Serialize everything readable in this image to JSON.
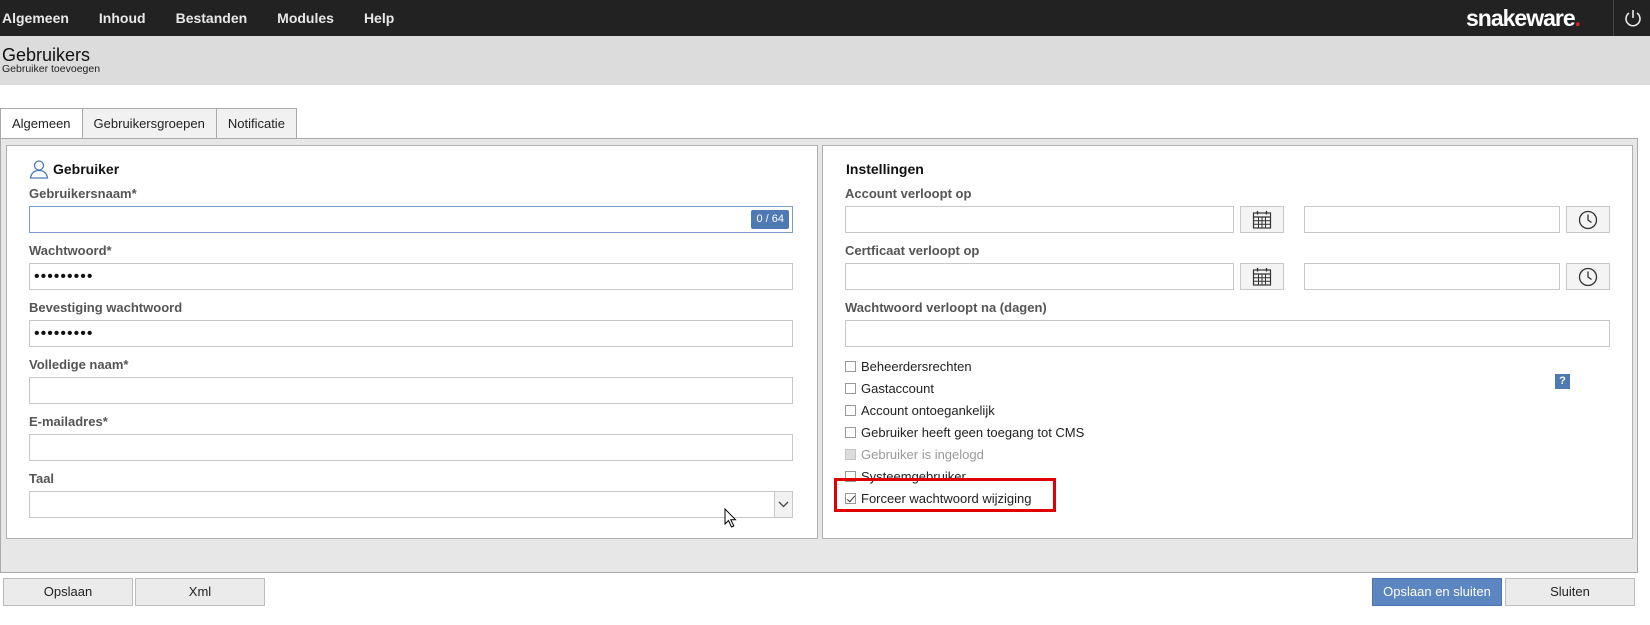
{
  "topnav": {
    "items": [
      "Algemeen",
      "Inhoud",
      "Bestanden",
      "Modules",
      "Help"
    ],
    "logo_text": "snakeware",
    "logo_dot": ".",
    "power_icon": "power-icon"
  },
  "header": {
    "title": "Gebruikers",
    "subtitle": "Gebruiker toevoegen"
  },
  "tabs": [
    {
      "label": "Algemeen",
      "active": true
    },
    {
      "label": "Gebruikersgroepen",
      "active": false
    },
    {
      "label": "Notificatie",
      "active": false
    }
  ],
  "user_panel": {
    "title": "Gebruiker",
    "icon": "user-icon",
    "username_label": "Gebruikersnaam*",
    "username_value": "",
    "username_counter": "0 / 64",
    "password_label": "Wachtwoord*",
    "password_value": "•••••••••",
    "confirm_label": "Bevestiging wachtwoord",
    "confirm_value": "•••••••••",
    "fullname_label": "Volledige naam*",
    "fullname_value": "",
    "email_label": "E-mailadres*",
    "email_value": "",
    "language_label": "Taal",
    "language_value": ""
  },
  "settings_panel": {
    "title": "Instellingen",
    "account_expires_label": "Account verloopt op",
    "certificate_expires_label": "Certficaat verloopt op",
    "password_expires_label": "Wachtwoord verloopt na (dagen)",
    "checkboxes": [
      {
        "label": "Beheerdersrechten",
        "checked": false,
        "disabled": false
      },
      {
        "label": "Gastaccount",
        "checked": false,
        "disabled": false
      },
      {
        "label": "Account ontoegankelijk",
        "checked": false,
        "disabled": false
      },
      {
        "label": "Gebruiker heeft geen toegang tot CMS",
        "checked": false,
        "disabled": false
      },
      {
        "label": "Gebruiker is ingelogd",
        "checked": false,
        "disabled": true
      },
      {
        "label": "Systeemgebruiker",
        "checked": false,
        "disabled": false
      },
      {
        "label": "Forceer wachtwoord wijziging",
        "checked": true,
        "disabled": false
      }
    ],
    "help_label": "?",
    "highlight_color": "#e00000"
  },
  "footer": {
    "save_label": "Opslaan",
    "xml_label": "Xml",
    "save_close_label": "Opslaan en sluiten",
    "close_label": "Sluiten"
  },
  "colors": {
    "topbar": "#222222",
    "accent": "#5b86c1",
    "header_bg": "#dcdcdc"
  }
}
